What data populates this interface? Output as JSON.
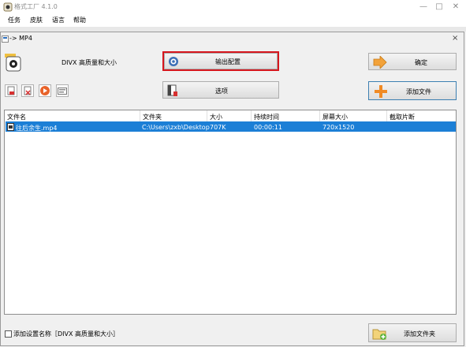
{
  "window": {
    "title": "格式工厂 4.1.0",
    "min_glyph": "—",
    "max_glyph": "□",
    "close_glyph": "✕"
  },
  "menu": [
    "任务",
    "皮肤",
    "语言",
    "帮助"
  ],
  "dialog": {
    "title": "-> MP4",
    "close_glyph": "×",
    "preset": "DIVX 高质量和大小",
    "output_config_label": "输出配置",
    "options_label": "选项",
    "ok_label": "确定",
    "add_file_label": "添加文件",
    "add_folder_label": "添加文件夹",
    "add_setting_name_label": "添加设置名称［DIVX 高质量和大小］"
  },
  "table": {
    "headers": [
      "文件名",
      "文件夹",
      "大小",
      "持续时间",
      "屏幕大小",
      "截取片断"
    ],
    "rows": [
      {
        "name": "往后余生.mp4",
        "folder": "C:\\Users\\zxb\\Desktop",
        "size": "707K",
        "duration": "00:00:11",
        "screen": "720x1520",
        "clip": ""
      }
    ]
  },
  "colors": {
    "highlight_border": "#d6161d",
    "selection": "#1c7fd6",
    "ok_arrow": "#f2a23a",
    "add_plus": "#f08a24",
    "primary_border": "#3c7fb1"
  }
}
